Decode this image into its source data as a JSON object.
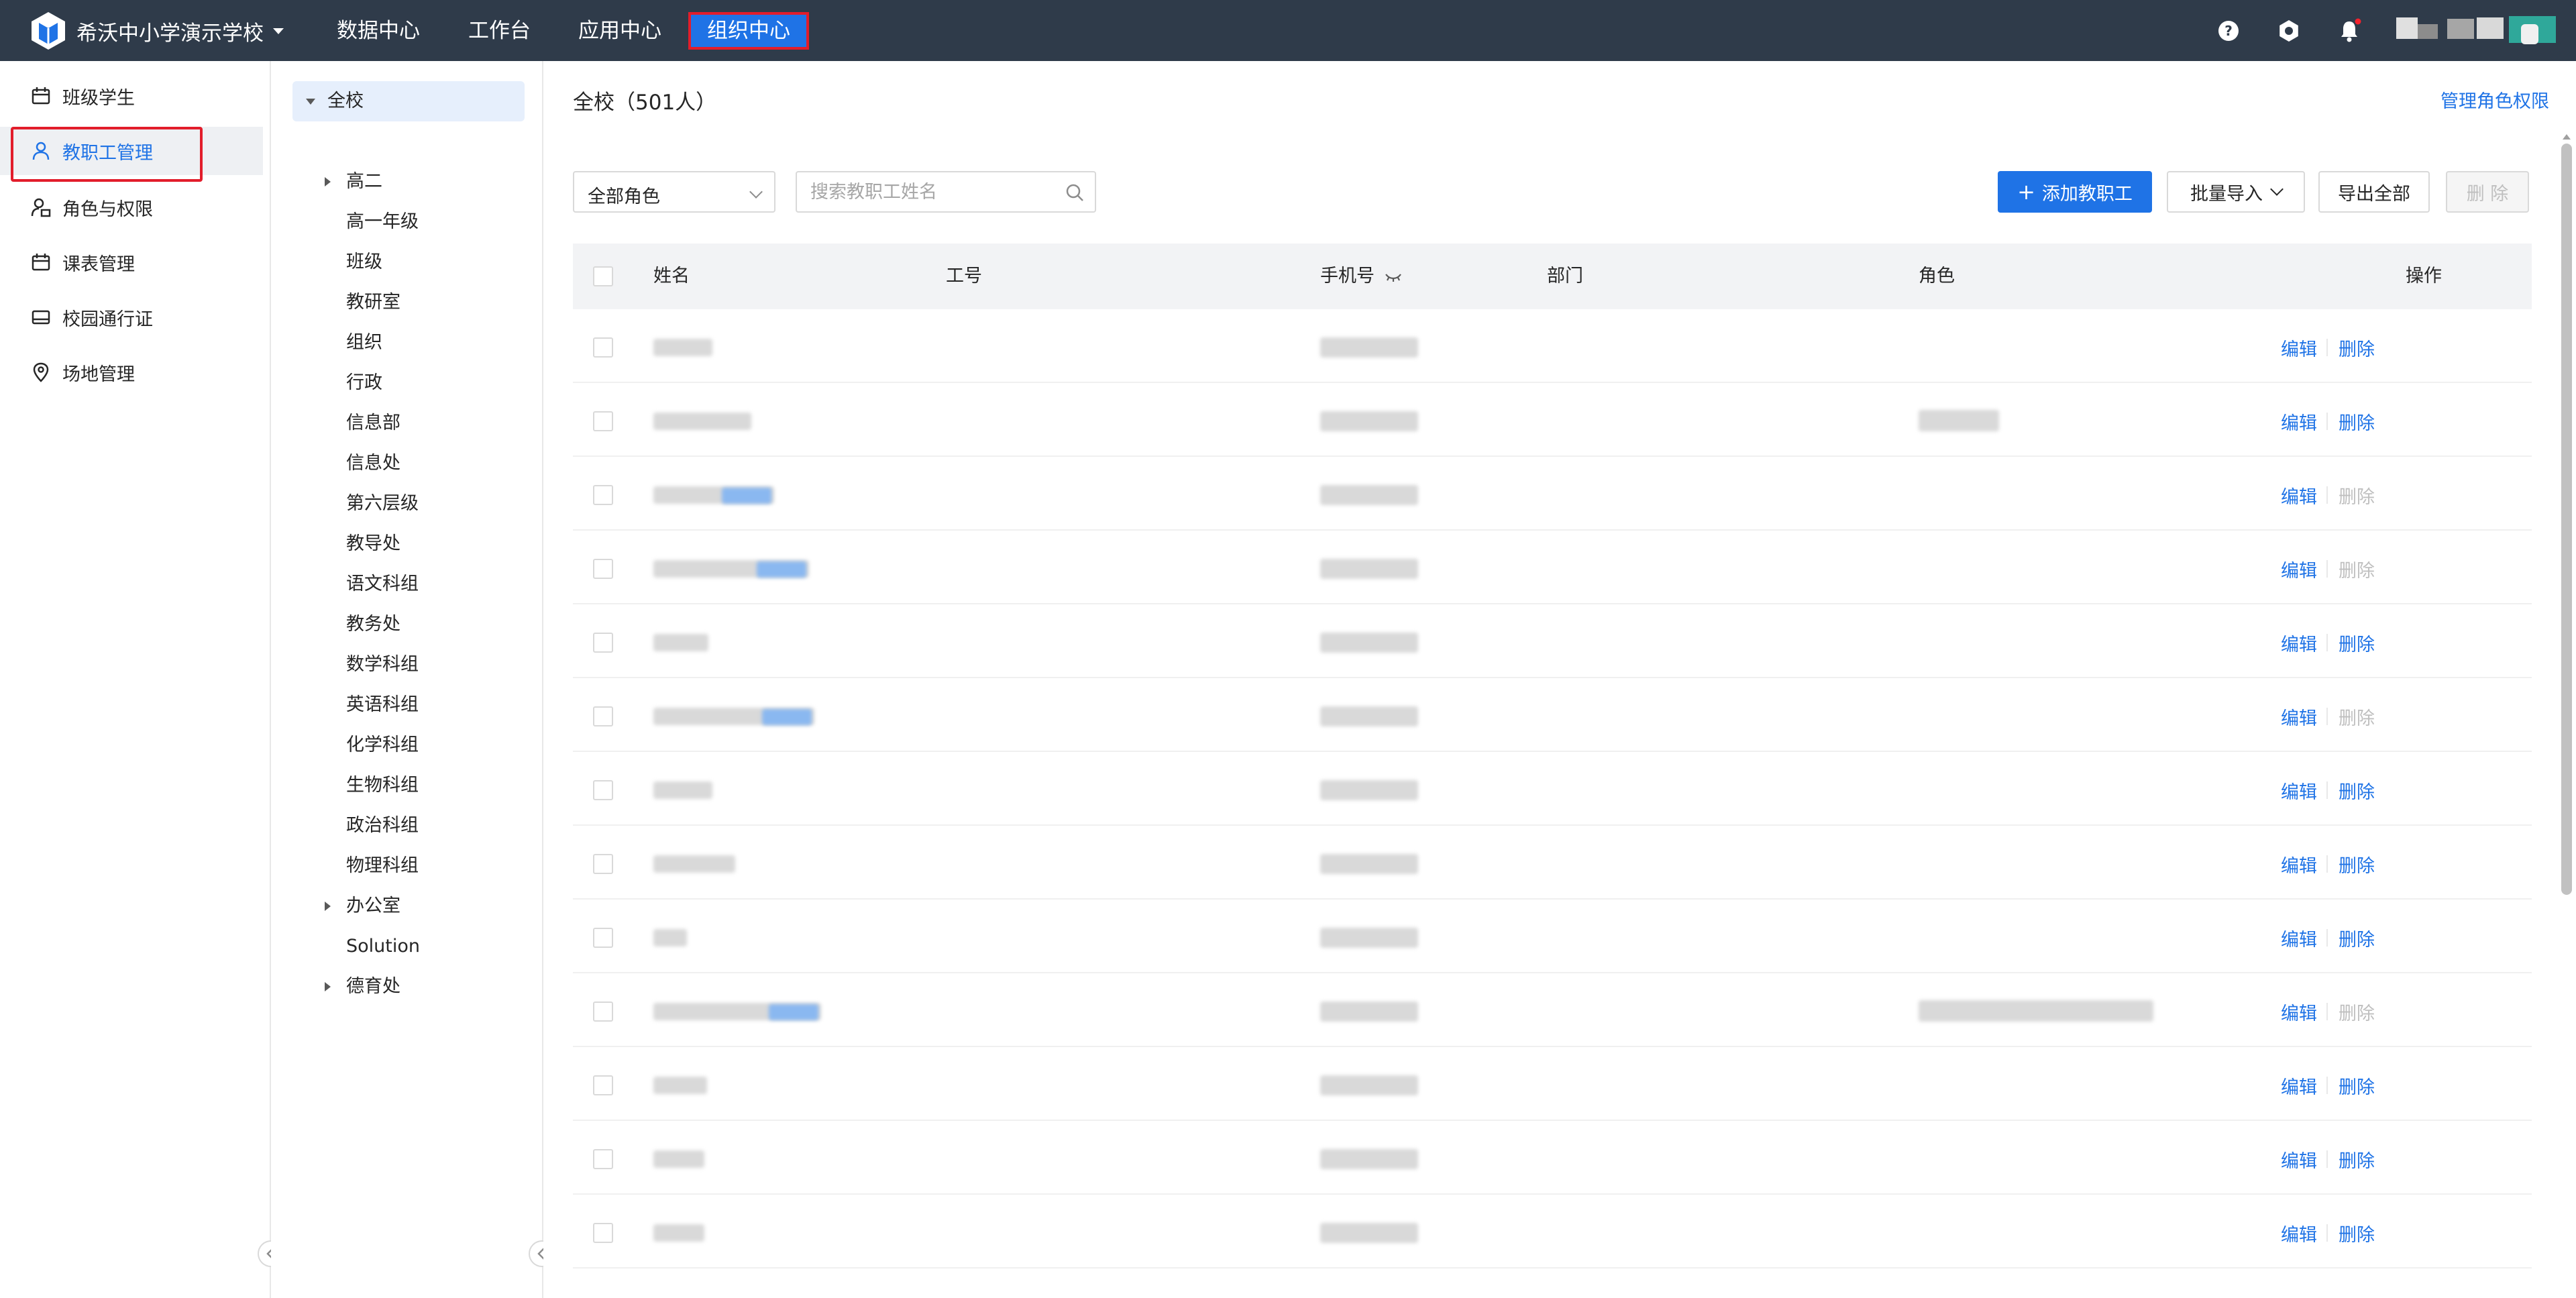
{
  "topbar": {
    "school_name": "希沃中小学演示学校",
    "nav": [
      "数据中心",
      "工作台",
      "应用中心",
      "组织中心"
    ],
    "active_nav": "组织中心"
  },
  "sidebar": {
    "items": [
      {
        "label": "班级学生",
        "icon": "calendar-icon"
      },
      {
        "label": "教职工管理",
        "icon": "user-icon"
      },
      {
        "label": "角色与权限",
        "icon": "user-lock-icon"
      },
      {
        "label": "课表管理",
        "icon": "calendar-icon"
      },
      {
        "label": "校园通行证",
        "icon": "card-icon"
      },
      {
        "label": "场地管理",
        "icon": "location-pin-icon"
      }
    ],
    "active": "教职工管理"
  },
  "tree": {
    "root": "全校",
    "nodes": [
      {
        "label": "高二",
        "expandable": true
      },
      {
        "label": "高一年级",
        "expandable": false
      },
      {
        "label": "班级",
        "expandable": false
      },
      {
        "label": "教研室",
        "expandable": false
      },
      {
        "label": "组织",
        "expandable": false
      },
      {
        "label": "行政",
        "expandable": false
      },
      {
        "label": "信息部",
        "expandable": false
      },
      {
        "label": "信息处",
        "expandable": false
      },
      {
        "label": "第六层级",
        "expandable": false
      },
      {
        "label": "教导处",
        "expandable": false
      },
      {
        "label": "语文科组",
        "expandable": false
      },
      {
        "label": "教务处",
        "expandable": false
      },
      {
        "label": "数学科组",
        "expandable": false
      },
      {
        "label": "英语科组",
        "expandable": false
      },
      {
        "label": "化学科组",
        "expandable": false
      },
      {
        "label": "生物科组",
        "expandable": false
      },
      {
        "label": "政治科组",
        "expandable": false
      },
      {
        "label": "物理科组",
        "expandable": false
      },
      {
        "label": "办公室",
        "expandable": true
      },
      {
        "label": "Solution",
        "expandable": false
      },
      {
        "label": "德育处",
        "expandable": true
      }
    ]
  },
  "main": {
    "title": "全校（501人）",
    "perm_link": "管理角色权限",
    "role_filter": "全部角色",
    "search_placeholder": "搜索教职工姓名",
    "buttons": {
      "add": "添加教职工",
      "import": "批量导入",
      "export": "导出全部",
      "delete": "删 除"
    },
    "columns": [
      "姓名",
      "工号",
      "手机号",
      "部门",
      "角色",
      "操作"
    ],
    "edit_label": "编辑",
    "delete_label": "删除",
    "rows": [
      {
        "delete_enabled": true
      },
      {
        "delete_enabled": true
      },
      {
        "delete_enabled": false
      },
      {
        "delete_enabled": false
      },
      {
        "delete_enabled": true
      },
      {
        "delete_enabled": false
      },
      {
        "delete_enabled": true
      },
      {
        "delete_enabled": true
      },
      {
        "delete_enabled": true
      },
      {
        "delete_enabled": false
      },
      {
        "delete_enabled": true
      },
      {
        "delete_enabled": true
      },
      {
        "delete_enabled": true
      }
    ]
  },
  "colors": {
    "topbar": "#2f3b4a",
    "accent": "#1f73e6",
    "highlight": "#e21d2b"
  }
}
